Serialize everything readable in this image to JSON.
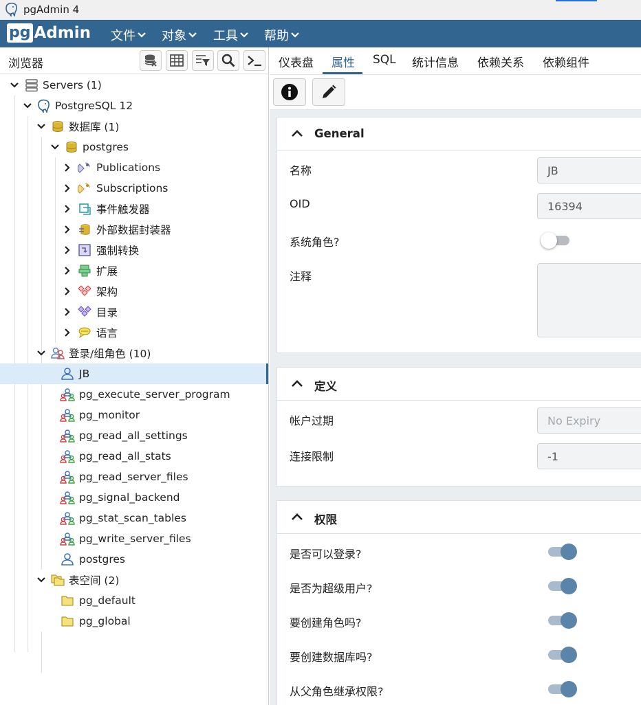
{
  "window": {
    "title": "pgAdmin 4"
  },
  "menubar": {
    "logo_pg": "pg",
    "logo_admin": "Admin",
    "items": [
      "文件",
      "对象",
      "工具",
      "帮助"
    ]
  },
  "browser": {
    "title": "浏览器",
    "tree": [
      {
        "label": "Servers (1)",
        "icon": "servers-icon",
        "expanded": true
      },
      {
        "label": "PostgreSQL 12",
        "icon": "postgres-elephant-icon",
        "expanded": true
      },
      {
        "label": "数据库 (1)",
        "icon": "databases-icon",
        "expanded": true
      },
      {
        "label": "postgres",
        "icon": "database-icon",
        "expanded": true
      },
      {
        "label": "Publications",
        "icon": "publication-icon",
        "expanded": false
      },
      {
        "label": "Subscriptions",
        "icon": "subscription-icon",
        "expanded": false
      },
      {
        "label": "事件触发器",
        "icon": "event-trigger-icon",
        "expanded": false
      },
      {
        "label": "外部数据封装器",
        "icon": "fdw-icon",
        "expanded": false
      },
      {
        "label": "强制转换",
        "icon": "cast-icon",
        "expanded": false
      },
      {
        "label": "扩展",
        "icon": "extension-icon",
        "expanded": false
      },
      {
        "label": "架构",
        "icon": "schema-icon",
        "expanded": false
      },
      {
        "label": "目录",
        "icon": "catalog-icon",
        "expanded": false
      },
      {
        "label": "语言",
        "icon": "language-icon",
        "expanded": false
      },
      {
        "label": "登录/组角色 (10)",
        "icon": "roles-icon",
        "expanded": true
      },
      {
        "label": "JB",
        "icon": "user-icon",
        "selected": true
      },
      {
        "label": "pg_execute_server_program",
        "icon": "group-role-icon"
      },
      {
        "label": "pg_monitor",
        "icon": "group-role-icon"
      },
      {
        "label": "pg_read_all_settings",
        "icon": "group-role-icon"
      },
      {
        "label": "pg_read_all_stats",
        "icon": "group-role-icon"
      },
      {
        "label": "pg_read_server_files",
        "icon": "group-role-icon"
      },
      {
        "label": "pg_signal_backend",
        "icon": "group-role-icon"
      },
      {
        "label": "pg_stat_scan_tables",
        "icon": "group-role-icon"
      },
      {
        "label": "pg_write_server_files",
        "icon": "group-role-icon"
      },
      {
        "label": "postgres",
        "icon": "user-icon"
      },
      {
        "label": "表空间 (2)",
        "icon": "tablespaces-icon",
        "expanded": true
      },
      {
        "label": "pg_default",
        "icon": "tablespace-icon"
      },
      {
        "label": "pg_global",
        "icon": "tablespace-icon"
      }
    ]
  },
  "tabs": [
    "仪表盘",
    "属性",
    "SQL",
    "统计信息",
    "依赖关系",
    "依赖组件"
  ],
  "active_tab": "属性",
  "properties": {
    "general": {
      "title": "General",
      "name_label": "名称",
      "name_value": "JB",
      "oid_label": "OID",
      "oid_value": "16394",
      "system_role_label": "系统角色?",
      "system_role": false,
      "comment_label": "注释"
    },
    "definition": {
      "title": "定义",
      "expiry_label": "帐户过期",
      "expiry_placeholder": "No Expiry",
      "conn_limit_label": "连接限制",
      "conn_limit_value": "-1"
    },
    "privileges": {
      "title": "权限",
      "items": [
        {
          "label": "是否可以登录?",
          "value": true
        },
        {
          "label": "是否为超级用户?",
          "value": true
        },
        {
          "label": "要创建角色吗?",
          "value": true
        },
        {
          "label": "要创建数据库吗?",
          "value": true
        },
        {
          "label": "从父角色继承权限?",
          "value": true
        }
      ]
    }
  },
  "colors": {
    "brand": "#326690",
    "selection": "#dcebf8",
    "toggle_on": "#5b84ab"
  }
}
